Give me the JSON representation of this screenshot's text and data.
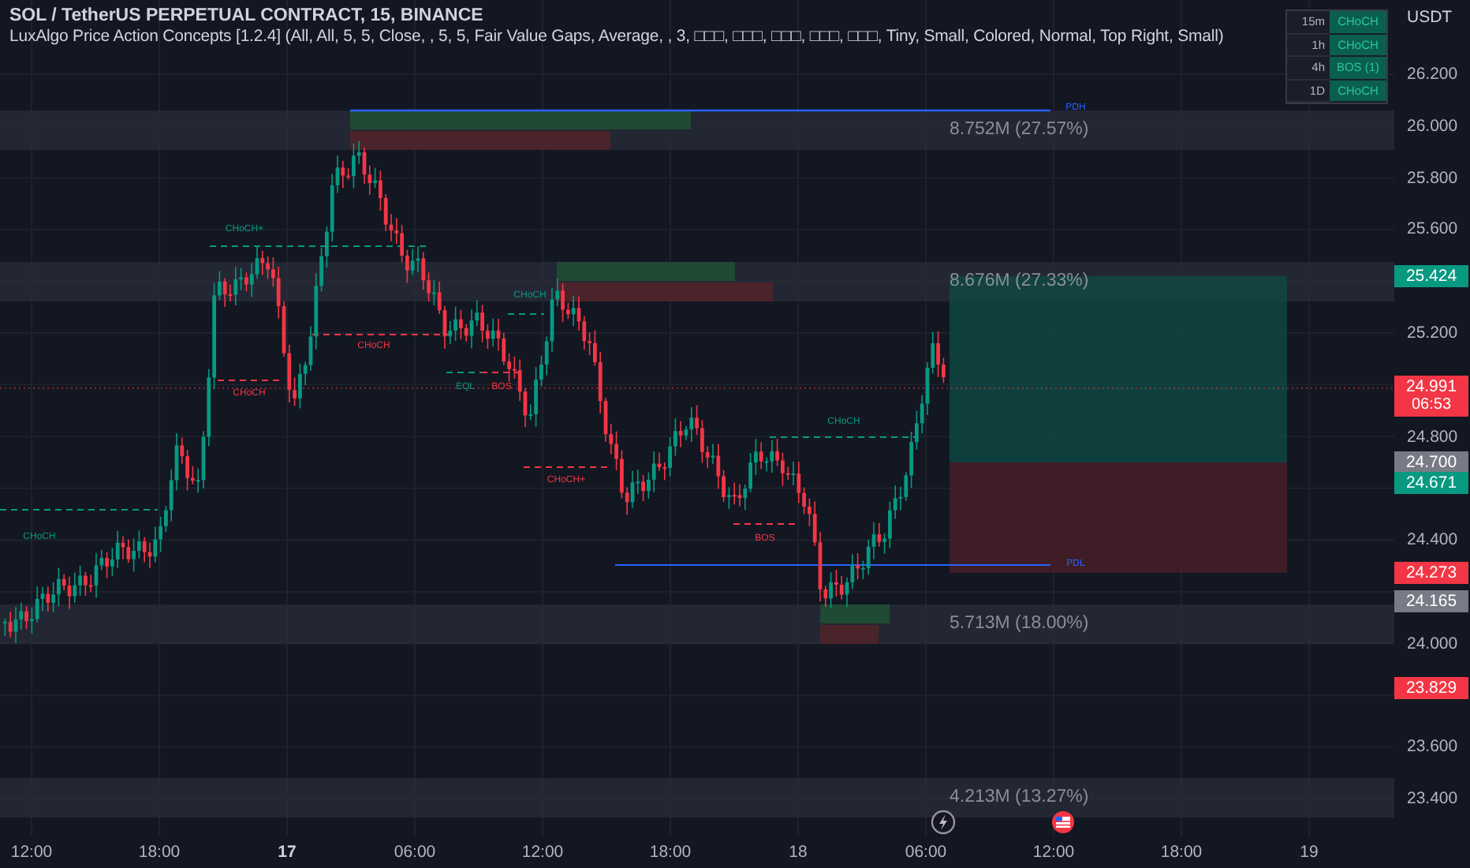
{
  "header": {
    "title": "SOL / TetherUS PERPETUAL CONTRACT, 15, BINANCE",
    "indicator": "LuxAlgo Price Action Concepts [1.2.4] (All, All, 5, 5, Close, , 5, 5, Fair Value Gaps, Average, , 3, □□□, □□□, □□□, □□□, □□□, Tiny, Small, Colored, Normal, Top Right, Small)"
  },
  "mtf_table": [
    {
      "timeframe": "15m",
      "signal": "CHoCH"
    },
    {
      "timeframe": "1h",
      "signal": "CHoCH"
    },
    {
      "timeframe": "4h",
      "signal": "BOS (1)"
    },
    {
      "timeframe": "1D",
      "signal": "CHoCH"
    }
  ],
  "price_axis": {
    "currency": "USDT",
    "ticks": [
      "26.200",
      "26.000",
      "25.800",
      "25.600",
      "25.200",
      "24.800",
      "24.400",
      "24.000",
      "23.600",
      "23.400"
    ]
  },
  "price_labels": [
    {
      "value": "25.424",
      "color": "#089981"
    },
    {
      "value": "24.991",
      "countdown": "06:53",
      "color": "#f23645"
    },
    {
      "value": "24.700",
      "color": "#787b86"
    },
    {
      "value": "24.671",
      "color": "#089981"
    },
    {
      "value": "24.273",
      "color": "#f23645"
    },
    {
      "value": "24.165",
      "color": "#787b86"
    },
    {
      "value": "23.829",
      "color": "#f23645"
    }
  ],
  "time_axis": [
    {
      "label": "12:00",
      "emphasized": false
    },
    {
      "label": "18:00",
      "emphasized": false
    },
    {
      "label": "17",
      "emphasized": true
    },
    {
      "label": "06:00",
      "emphasized": false
    },
    {
      "label": "12:00",
      "emphasized": false
    },
    {
      "label": "18:00",
      "emphasized": false
    },
    {
      "label": "18",
      "emphasized": false
    },
    {
      "label": "06:00",
      "emphasized": false
    },
    {
      "label": "12:00",
      "emphasized": false
    },
    {
      "label": "18:00",
      "emphasized": false
    },
    {
      "label": "19",
      "emphasized": false
    }
  ],
  "volume_profile": [
    "8.752M (27.57%)",
    "8.676M (27.33%)",
    "5.713M (18.00%)",
    "4.213M (13.27%)"
  ],
  "structure_labels": [
    {
      "text": "CHoCH+",
      "color": "#089981"
    },
    {
      "text": "CHoCH",
      "color": "#f23645"
    },
    {
      "text": "CHoCH",
      "color": "#f23645"
    },
    {
      "text": "EQL",
      "color": "#089981"
    },
    {
      "text": "BOS",
      "color": "#f23645"
    },
    {
      "text": "CHoCH",
      "color": "#089981"
    },
    {
      "text": "CHoCH+",
      "color": "#f23645"
    },
    {
      "text": "CHoCH",
      "color": "#089981"
    },
    {
      "text": "BOS",
      "color": "#f23645"
    },
    {
      "text": "CHoCH",
      "color": "#089981"
    },
    {
      "text": "PDH",
      "color": "#2962ff"
    },
    {
      "text": "PDL",
      "color": "#2962ff"
    }
  ]
}
